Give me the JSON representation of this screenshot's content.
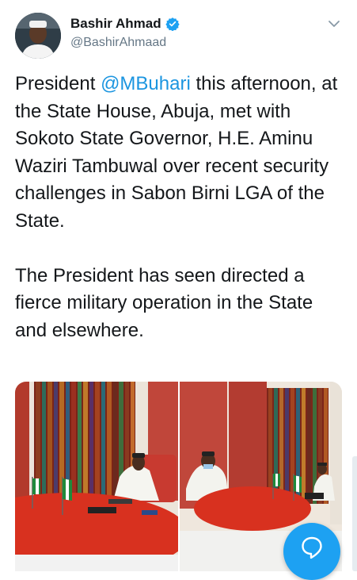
{
  "author": {
    "display_name": "Bashir Ahmad",
    "handle": "@BashirAhmaad",
    "verified": true
  },
  "tweet": {
    "p1_before": "President ",
    "mention": "@MBuhari",
    "p1_after": " this afternoon, at the State House, Abuja, met with Sokoto State Governor, H.E. Aminu Waziri Tambuwal over recent security challenges in Sabon Birni LGA of the State.",
    "p2": "The President has seen directed a fierce military operation in the State and elsewhere."
  },
  "colors": {
    "link": "#1b95e0",
    "verified": "#1da1f2",
    "fab": "#1da1f2",
    "table": "#d8311f"
  },
  "icons": {
    "verified": "verified-badge-icon",
    "caret": "chevron-down-icon",
    "compose": "compose-reply-icon"
  }
}
